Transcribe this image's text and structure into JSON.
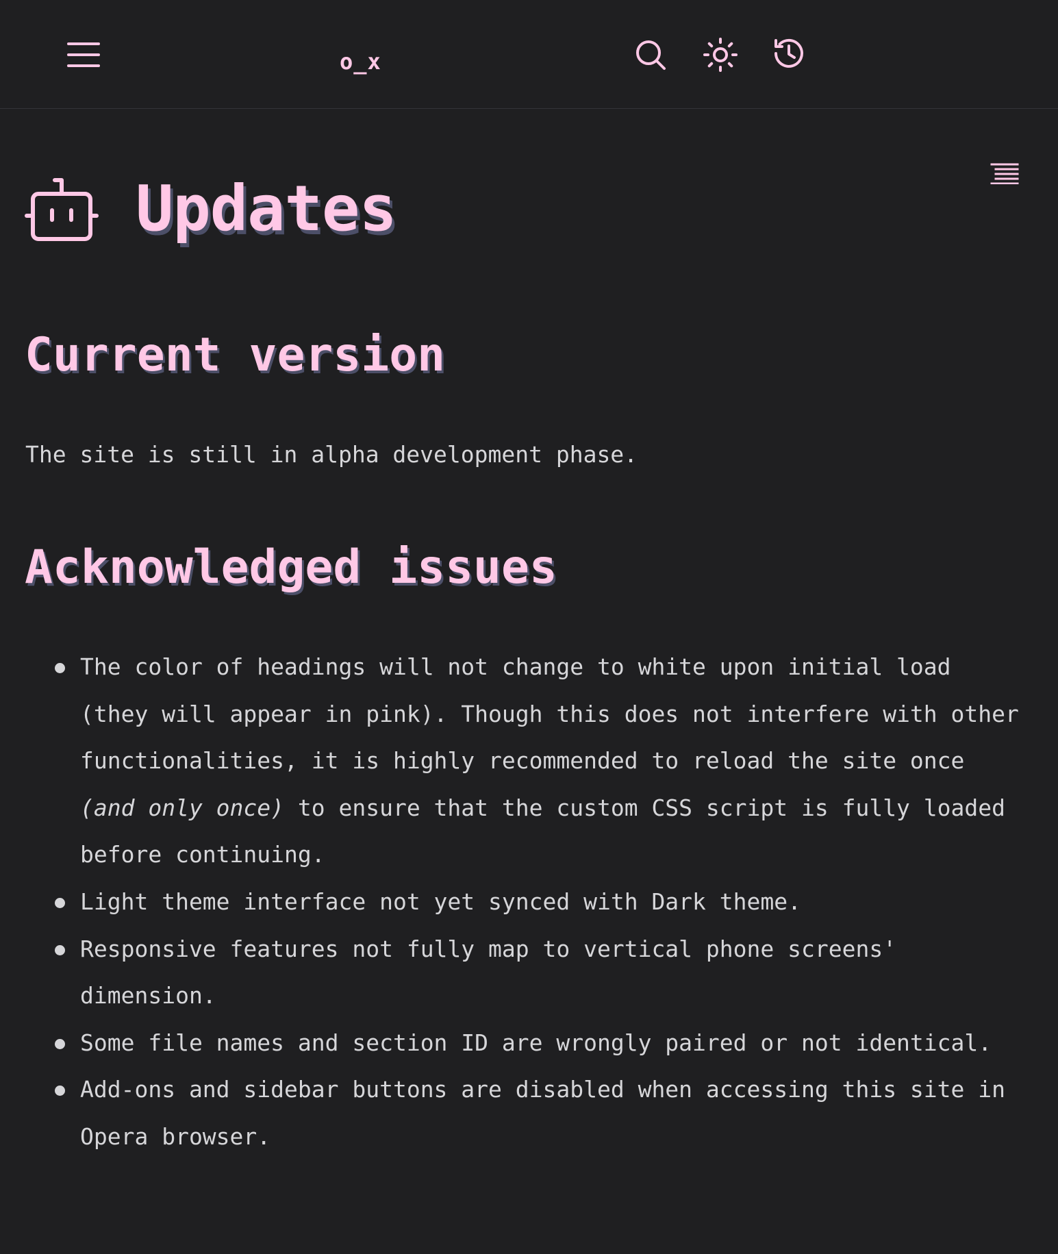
{
  "header": {
    "site_title": "o_x",
    "menu_icon": "menu-icon",
    "search_icon": "search-icon",
    "theme_icon": "sun-icon",
    "history_icon": "history-icon"
  },
  "page": {
    "title_icon": "robot-icon",
    "title": "Updates",
    "toc_icon": "table-of-contents-icon"
  },
  "sections": {
    "current": {
      "heading": "Current version",
      "text": "The site is still in alpha development phase."
    },
    "issues": {
      "heading": "Acknowledged issues",
      "items": [
        {
          "before": "The color of headings will not change to white upon initial load (they will appear in pink). Though this does not interfere with other functionalities, it is highly recommended to reload the site once ",
          "emphasis": "(and only once)",
          "after": " to ensure that the custom CSS script is fully loaded before continuing."
        },
        {
          "text": "Light theme interface not yet synced with Dark theme."
        },
        {
          "text": "Responsive features not fully map to vertical phone screens' dimension."
        },
        {
          "text": "Some file names and section ID are wrongly paired or not identical."
        },
        {
          "text": "Add-ons and sidebar buttons are disabled when accessing this site in Opera browser."
        }
      ]
    }
  },
  "colors": {
    "background": "#1f1f21",
    "accent_pink": "#ffc8e6",
    "heading_shadow": "#4c4f68",
    "body_text": "#d6d6d9"
  }
}
